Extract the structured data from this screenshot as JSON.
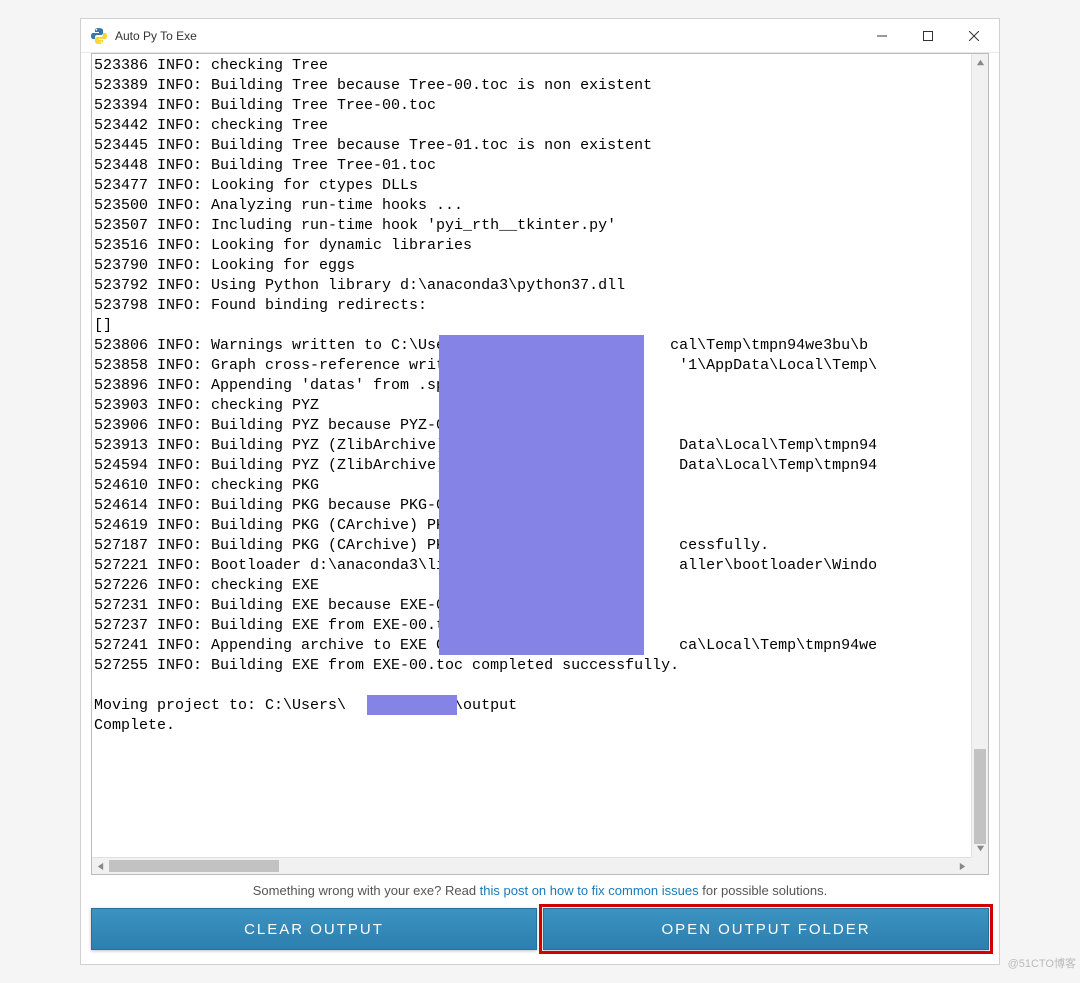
{
  "titlebar": {
    "title": "Auto Py To Exe"
  },
  "log_lines": [
    "523386 INFO: checking Tree",
    "523389 INFO: Building Tree because Tree-00.toc is non existent",
    "523394 INFO: Building Tree Tree-00.toc",
    "523442 INFO: checking Tree",
    "523445 INFO: Building Tree because Tree-01.toc is non existent",
    "523448 INFO: Building Tree Tree-01.toc",
    "523477 INFO: Looking for ctypes DLLs",
    "523500 INFO: Analyzing run-time hooks ...",
    "523507 INFO: Including run-time hook 'pyi_rth__tkinter.py'",
    "523516 INFO: Looking for dynamic libraries",
    "523790 INFO: Looking for eggs",
    "523792 INFO: Using Python library d:\\anaconda3\\python37.dll",
    "523798 INFO: Found binding redirects:",
    "[]",
    "523806 INFO: Warnings written to C:\\Users\\                      cal\\Temp\\tmpn94we3bu\\b",
    "523858 INFO: Graph cross-reference writte                        '1\\AppData\\Local\\Temp\\",
    "523896 INFO: Appending 'datas' from .spec",
    "523903 INFO: checking PYZ",
    "523906 INFO: Building PYZ because PYZ-00.",
    "523913 INFO: Building PYZ (ZlibArchive) C                        Data\\Local\\Temp\\tmpn94",
    "524594 INFO: Building PYZ (ZlibArchive) C                        Data\\Local\\Temp\\tmpn94",
    "524610 INFO: checking PKG",
    "524614 INFO: Building PKG because PKG-00.",
    "524619 INFO: Building PKG (CArchive) PKG-",
    "527187 INFO: Building PKG (CArchive) PKG-                        cessfully.",
    "527221 INFO: Bootloader d:\\anaconda3\\lib\\                        aller\\bootloader\\Windo",
    "527226 INFO: checking EXE",
    "527231 INFO: Building EXE because EXE-00.",
    "527237 INFO: Building EXE from EXE-00.toc",
    "527241 INFO: Appending archive to EXE C:\\                        ca\\Local\\Temp\\tmpn94we",
    "527255 INFO: Building EXE from EXE-00.toc completed successfully.",
    "",
    "Moving project to: C:\\Users\\            \\output",
    "Complete."
  ],
  "hint": {
    "prefix": "Something wrong with your exe? Read ",
    "link": "this post on how to fix common issues",
    "suffix": " for possible solutions."
  },
  "buttons": {
    "clear": "CLEAR OUTPUT",
    "open": "OPEN OUTPUT FOLDER"
  },
  "watermark": "@51CTO博客"
}
